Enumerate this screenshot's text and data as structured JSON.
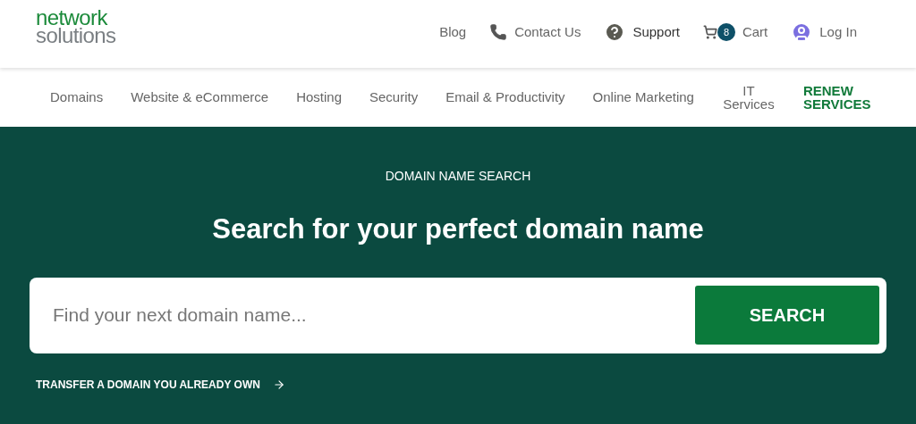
{
  "logo": {
    "line_1": "network",
    "line_2": "solutions"
  },
  "top_links": [
    {
      "kind": "text",
      "label": "Blog"
    },
    {
      "kind": "phone",
      "label": "Contact Us"
    },
    {
      "kind": "help",
      "label": "Support"
    },
    {
      "kind": "cart",
      "label": "Cart",
      "badge": "8"
    },
    {
      "kind": "user",
      "label": "Log In"
    }
  ],
  "nav": [
    {
      "kind": "plain",
      "label": "Domains"
    },
    {
      "kind": "plain",
      "label": "Website & eCommerce"
    },
    {
      "kind": "plain",
      "label": "Hosting"
    },
    {
      "kind": "plain",
      "label": "Security"
    },
    {
      "kind": "plain",
      "label": "Email & Productivity"
    },
    {
      "kind": "plain",
      "label": "Online Marketing"
    },
    {
      "kind": "stacked",
      "label": "IT Services"
    },
    {
      "kind": "promo",
      "label": "RENEW SERVICES"
    }
  ],
  "hero": {
    "eyebrow": "DOMAIN NAME SEARCH",
    "heading": "Search for your perfect domain name",
    "search": {
      "placeholder": "Find your next domain name...",
      "button": "SEARCH"
    },
    "transfer_link": "TRANSFER A DOMAIN YOU ALREADY OWN"
  }
}
